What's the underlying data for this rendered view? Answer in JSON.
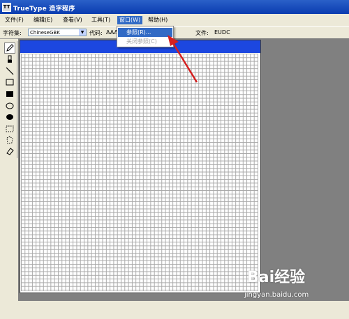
{
  "window": {
    "title": "TrueType 造字程序",
    "app_icon": "TT"
  },
  "menubar": {
    "items": [
      {
        "label": "文件(F)"
      },
      {
        "label": "编辑(E)"
      },
      {
        "label": "查看(V)"
      },
      {
        "label": "工具(T)"
      },
      {
        "label": "窗口(W)"
      },
      {
        "label": "帮助(H)"
      }
    ]
  },
  "toolbar": {
    "charset_label": "字符集:",
    "charset_value": "ChineseGBK",
    "code_label": "代码:",
    "code_value": "AAA1",
    "file_label": "文件:",
    "file_value": "EUDC"
  },
  "window_menu": {
    "items": [
      {
        "label": "参照(R)...",
        "enabled": true
      },
      {
        "label": "关闭参照(C)",
        "enabled": false
      }
    ]
  },
  "tools": [
    "pencil-icon",
    "brush-icon",
    "line-icon",
    "hollow-rectangle-icon",
    "filled-rectangle-icon",
    "hollow-ellipse-icon",
    "filled-ellipse-icon",
    "rect-select-icon",
    "freeform-select-icon",
    "eraser-icon"
  ],
  "watermark": {
    "brand": "Bai经验",
    "brand_suffix": "经验",
    "url": "jingyan.baidu.com"
  },
  "colors": {
    "title_bar": "#0a3cb0",
    "editor_title": "#1c47e0",
    "menu_highlight": "#316ac5",
    "annotation_arrow": "#d42020",
    "workspace_bg": "#808080"
  }
}
